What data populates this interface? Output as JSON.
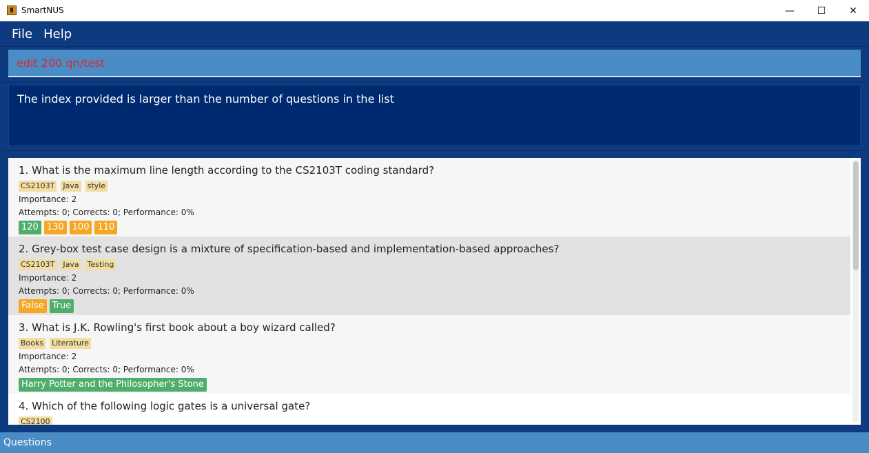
{
  "window": {
    "title": "SmartNUS",
    "minimize": "—",
    "maximize": "☐",
    "close": "✕"
  },
  "menu": {
    "file": "File",
    "help": "Help"
  },
  "command": {
    "value": "edit 200 qn/test"
  },
  "result": {
    "message": "The index provided is larger than the number of questions in the list"
  },
  "questions": [
    {
      "text": "1. What is the maximum line length according to the CS2103T coding standard?",
      "tags": [
        "CS2103T",
        "Java",
        "style"
      ],
      "importance": "Importance: 2",
      "stats": "Attempts: 0; Corrects: 0; Performance: 0%",
      "answers": [
        {
          "label": "120",
          "status": "correct"
        },
        {
          "label": "130",
          "status": "wrong"
        },
        {
          "label": "100",
          "status": "wrong"
        },
        {
          "label": "110",
          "status": "wrong"
        }
      ]
    },
    {
      "text": "2. Grey-box test case design is a mixture of specification-based and implementation-based approaches?",
      "tags": [
        "CS2103T",
        "Java",
        "Testing"
      ],
      "importance": "Importance: 2",
      "stats": "Attempts: 0; Corrects: 0; Performance: 0%",
      "answers": [
        {
          "label": "False",
          "status": "wrong"
        },
        {
          "label": "True",
          "status": "correct"
        }
      ]
    },
    {
      "text": "3. What is J.K. Rowling's first book about a boy wizard called?",
      "tags": [
        "Books",
        "Literature"
      ],
      "importance": "Importance: 2",
      "stats": "Attempts: 0; Corrects: 0; Performance: 0%",
      "answers": [
        {
          "label": "Harry Potter and the Philosopher's Stone",
          "status": "correct"
        }
      ]
    },
    {
      "text": "4. Which of the following logic gates is a universal gate?",
      "tags": [
        "CS2100"
      ]
    }
  ],
  "status": {
    "label": "Questions"
  },
  "colors": {
    "correct": "#4fae6b",
    "wrong": "#f5a623",
    "tag": "#f3dda0",
    "command_error": "#e0262a",
    "background": "#0e3a80"
  }
}
